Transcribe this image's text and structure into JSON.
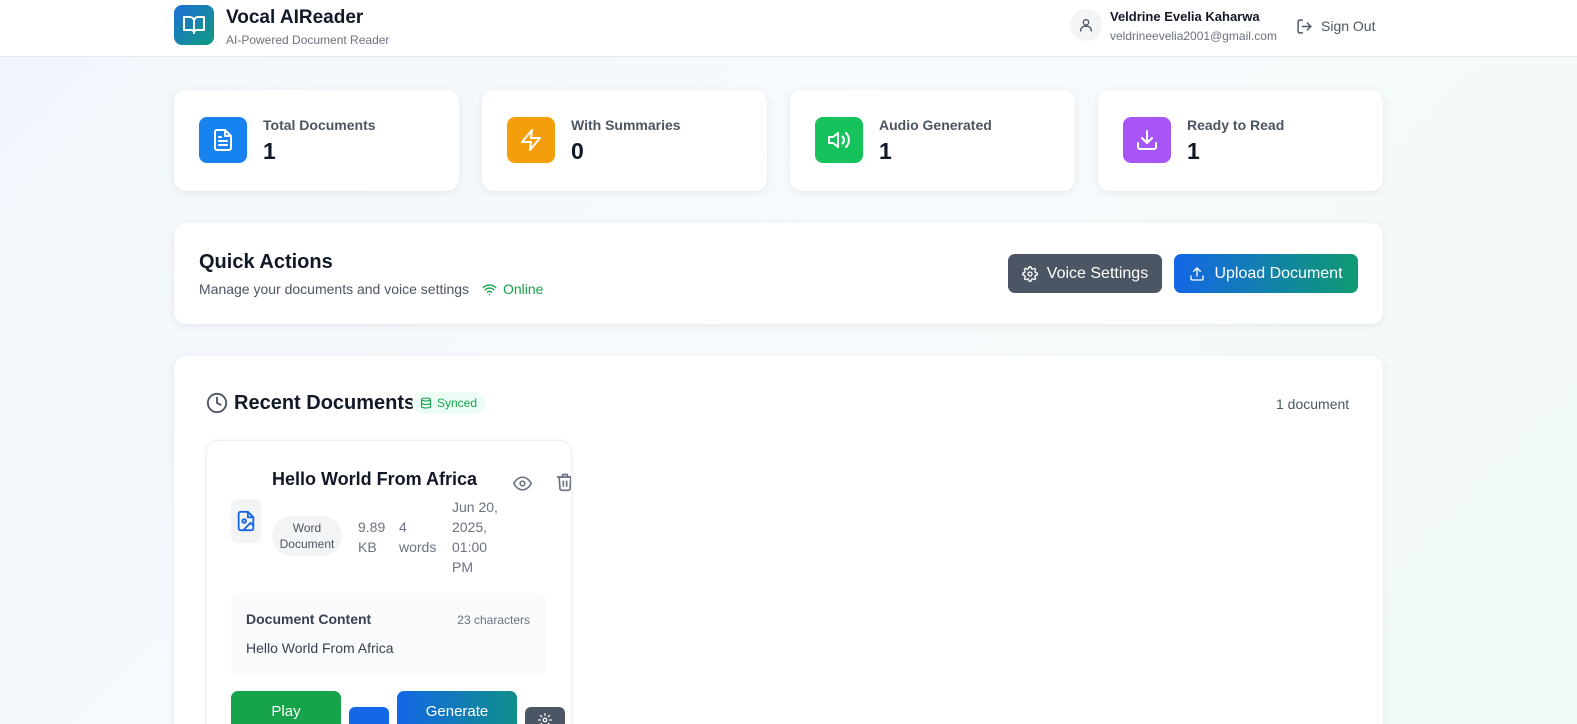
{
  "app": {
    "title": "Vocal AIReader",
    "subtitle": "AI-Powered Document Reader",
    "brand_colors": [
      "#1f6fd6",
      "#0f9a7f"
    ]
  },
  "user": {
    "name": "Veldrine Evelia Kaharwa",
    "email": "veldrineevelia2001@gmail.com",
    "sign_out_label": "Sign Out"
  },
  "stats": [
    {
      "label": "Total Documents",
      "value": "1",
      "icon": "file-text-icon",
      "color": "#1683f0"
    },
    {
      "label": "With Summaries",
      "value": "0",
      "icon": "lightning-icon",
      "color": "#f59e0b"
    },
    {
      "label": "Audio Generated",
      "value": "1",
      "icon": "volume-icon",
      "color": "#16c25c"
    },
    {
      "label": "Ready to Read",
      "value": "1",
      "icon": "download-icon",
      "color": "#a855f7"
    }
  ],
  "quick_actions": {
    "title": "Quick Actions",
    "description": "Manage your documents and voice settings",
    "status": "Online",
    "voice_settings_label": "Voice Settings",
    "upload_label": "Upload Document"
  },
  "recent": {
    "title": "Recent Documents",
    "synced_label": "Synced",
    "count_label": "1 document",
    "documents": [
      {
        "title": "Hello World From Africa",
        "type": "Word Document",
        "size": "9.89 KB",
        "words": "4 words",
        "date": "Jun 20, 2025, 01:00 PM",
        "content_label": "Document Content",
        "characters": "23 characters",
        "content": "Hello World From Africa",
        "play_label": "Play",
        "generate_label": "Generate"
      }
    ]
  }
}
